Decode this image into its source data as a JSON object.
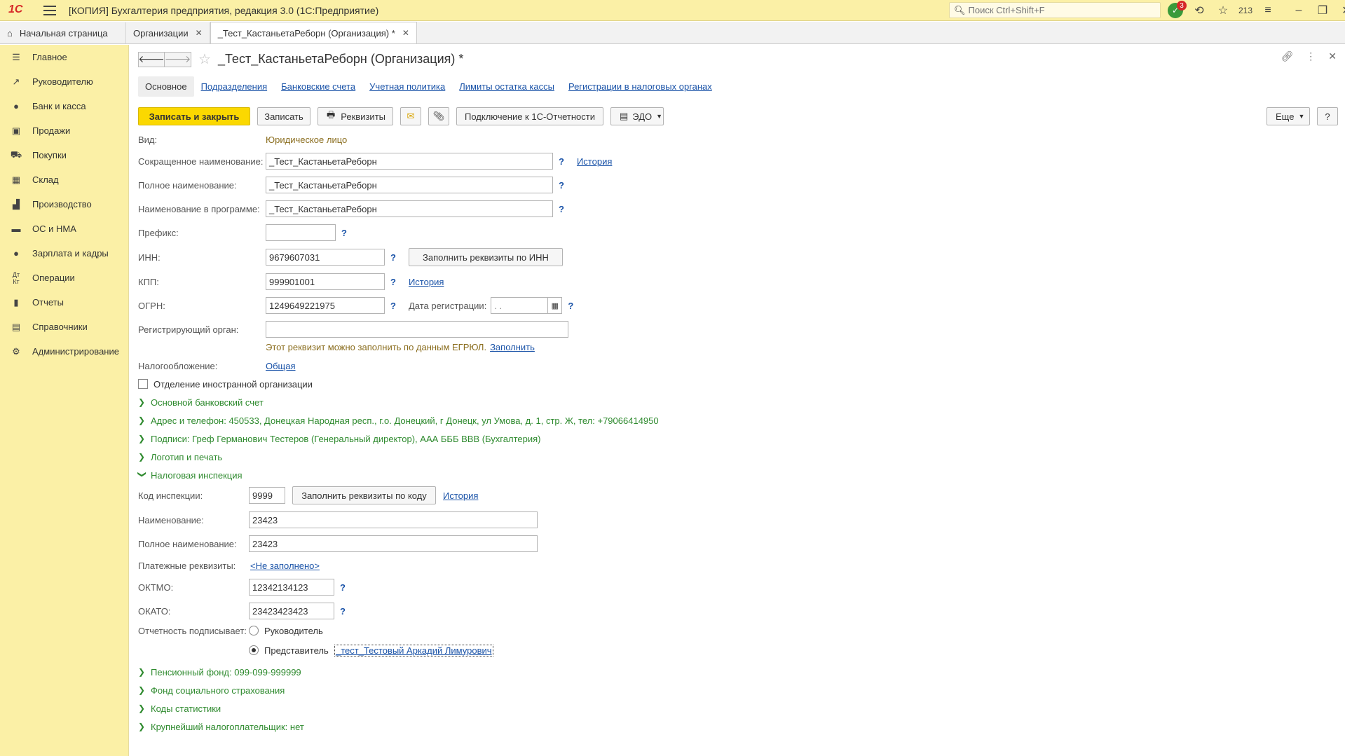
{
  "app": {
    "logo": "1С",
    "title": "[КОПИЯ] Бухгалтерия предприятия, редакция 3.0  (1С:Предприятие)",
    "search_placeholder": "Поиск Ctrl+Shift+F",
    "notif_count": "3",
    "history_count": "213"
  },
  "tabs": [
    {
      "label": "Начальная страница"
    },
    {
      "label": "Организации"
    },
    {
      "label": "_Тест_КастаньетаРеборн (Организация) *"
    }
  ],
  "sidebar": {
    "items": [
      {
        "label": "Главное",
        "icon": "menu-icon"
      },
      {
        "label": "Руководителю",
        "icon": "trend-icon"
      },
      {
        "label": "Банк и касса",
        "icon": "coin-icon"
      },
      {
        "label": "Продажи",
        "icon": "bag-icon"
      },
      {
        "label": "Покупки",
        "icon": "cart-icon"
      },
      {
        "label": "Склад",
        "icon": "grid-icon"
      },
      {
        "label": "Производство",
        "icon": "factory-icon"
      },
      {
        "label": "ОС и НМА",
        "icon": "truck-icon"
      },
      {
        "label": "Зарплата и кадры",
        "icon": "person-icon"
      },
      {
        "label": "Операции",
        "icon": "dt-kt-icon"
      },
      {
        "label": "Отчеты",
        "icon": "chart-icon"
      },
      {
        "label": "Справочники",
        "icon": "book-icon"
      },
      {
        "label": "Администрирование",
        "icon": "gear-icon"
      }
    ]
  },
  "form": {
    "title": "_Тест_КастаньетаРеборн (Организация) *",
    "tabs": [
      {
        "label": "Основное"
      },
      {
        "label": "Подразделения"
      },
      {
        "label": "Банковские счета"
      },
      {
        "label": "Учетная политика"
      },
      {
        "label": "Лимиты остатка кассы"
      },
      {
        "label": "Регистрации в налоговых органах"
      }
    ],
    "commands": {
      "save_close": "Записать и закрыть",
      "save": "Записать",
      "requisites": "Реквизиты",
      "connect": "Подключение к 1С-Отчетности",
      "edo": "ЭДО",
      "more": "Еще",
      "help": "?"
    },
    "vid_label": "Вид:",
    "vid_value": "Юридическое лицо",
    "short_name_label": "Сокращенное наименование:",
    "short_name": "_Тест_КастаньетаРеборн",
    "full_name_label": "Полное наименование:",
    "full_name": "_Тест_КастаньетаРеборн",
    "prog_name_label": "Наименование в программе:",
    "prog_name": "_Тест_КастаньетаРеборн",
    "prefix_label": "Префикс:",
    "prefix": "",
    "inn_label": "ИНН:",
    "inn": "9679607031",
    "fill_by_inn": "Заполнить реквизиты по ИНН",
    "kpp_label": "КПП:",
    "kpp": "999901001",
    "ogrn_label": "ОГРН:",
    "ogrn": "1249649221975",
    "reg_date_label": "Дата регистрации:",
    "reg_date": " .  .",
    "reg_organ_label": "Регистрирующий орган:",
    "reg_organ": "",
    "egrul_hint": "Этот реквизит можно заполнить по данным ЕГРЮЛ.",
    "fill_link": "Заполнить",
    "history_link": "История",
    "tax_label": "Налогообложение:",
    "tax_value": "Общая",
    "foreign_branch": "Отделение иностранной организации",
    "groups": {
      "bank": "Основной банковский счет",
      "address": "Адрес и телефон: 450533, Донецкая Народная респ., г.о. Донецкий, г Донецк, ул Умова, д. 1, стр. Ж, тел: +79066414950",
      "signatures": "Подписи: Греф Германович Тестеров (Генеральный директор), ААА БББ ВВВ (Бухгалтерия)",
      "logo": "Логотип и печать",
      "tax_office": "Налоговая инспекция",
      "pension": "Пенсионный фонд: 099-099-999999",
      "social": "Фонд социального страхования",
      "stats": "Коды статистики",
      "largest": "Крупнейший налогоплательщик: нет"
    },
    "inspection": {
      "code_label": "Код инспекции:",
      "code": "9999",
      "fill_by_code": "Заполнить реквизиты по коду",
      "name_label": "Наименование:",
      "name": "23423",
      "full_name_label": "Полное наименование:",
      "full_name": "23423",
      "payment_label": "Платежные реквизиты:",
      "payment_value": "<Не заполнено>",
      "oktmo_label": "ОКТМО:",
      "oktmo": "12342134123",
      "okato_label": "ОКАТО:",
      "okato": "23423423423",
      "signer_label": "Отчетность подписывает:",
      "signer_head": "Руководитель",
      "signer_rep": "Представитель",
      "rep_name": "_тест_Тестовый Аркадий Лимурович"
    }
  }
}
